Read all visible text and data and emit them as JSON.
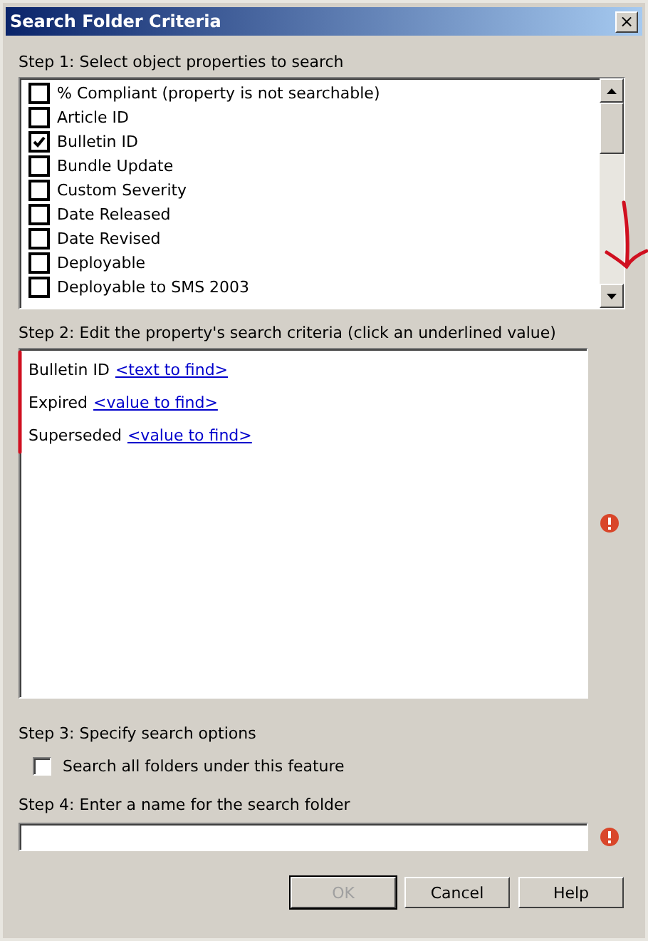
{
  "window": {
    "title": "Search Folder Criteria",
    "close": "×"
  },
  "step1": {
    "label": "Step 1: Select object properties to search",
    "properties": [
      {
        "name": "% Compliant (property is not searchable)",
        "checked": false
      },
      {
        "name": "Article ID",
        "checked": false
      },
      {
        "name": "Bulletin ID",
        "checked": true
      },
      {
        "name": "Bundle Update",
        "checked": false
      },
      {
        "name": "Custom Severity",
        "checked": false
      },
      {
        "name": "Date Released",
        "checked": false
      },
      {
        "name": "Date Revised",
        "checked": false
      },
      {
        "name": "Deployable",
        "checked": false
      },
      {
        "name": "Deployable to SMS 2003",
        "checked": false
      }
    ]
  },
  "step2": {
    "label": "Step 2: Edit the property's search criteria (click an underlined value)",
    "criteria": [
      {
        "name": "Bulletin ID",
        "value": "<text to find>"
      },
      {
        "name": "Expired",
        "value": "<value to find>"
      },
      {
        "name": "Superseded",
        "value": "<value to find>"
      }
    ]
  },
  "step3": {
    "label": "Step 3: Specify search options",
    "option": {
      "label": "Search all folders under this feature",
      "checked": false
    }
  },
  "step4": {
    "label": "Step 4: Enter a name for the search folder"
  },
  "buttons": [
    {
      "label": "OK",
      "disabled": true
    },
    {
      "label": "Cancel",
      "disabled": false
    },
    {
      "label": "Help",
      "disabled": false
    }
  ]
}
